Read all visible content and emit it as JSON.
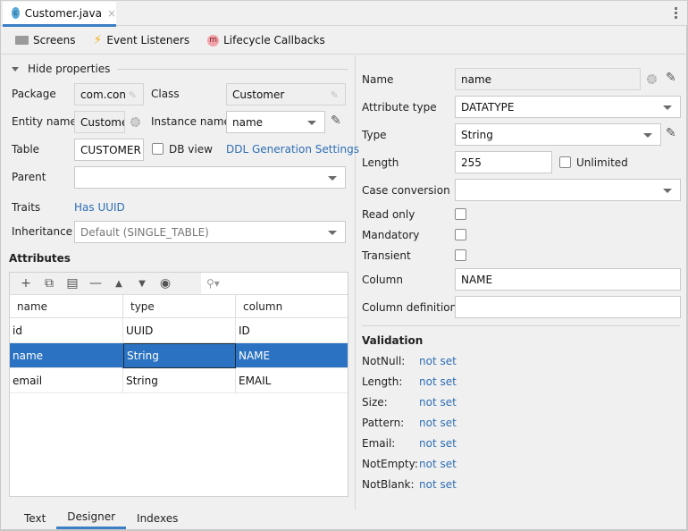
{
  "tabbar": {
    "file_tab": {
      "icon": "class-c-icon",
      "icon_letter": "c",
      "label": "Customer.java",
      "close": "×"
    },
    "more_icon": "more-vertical-icon"
  },
  "toolbar": {
    "items": [
      {
        "icon": "monitor-icon",
        "label": "Screens"
      },
      {
        "icon": "lightning-icon",
        "label": "Event Listeners"
      },
      {
        "icon": "method-m-icon",
        "icon_letter": "m",
        "label": "Lifecycle Callbacks"
      }
    ]
  },
  "properties": {
    "toggle_label": "Hide properties",
    "package": {
      "label": "Package",
      "value": "com.con"
    },
    "class": {
      "label": "Class",
      "value": "Customer"
    },
    "entity_name": {
      "label": "Entity name",
      "value": "Custome"
    },
    "instance_name": {
      "label": "Instance name",
      "value": "name"
    },
    "table": {
      "label": "Table",
      "value": "CUSTOMER"
    },
    "db_view": {
      "label": "DB view",
      "checked": false
    },
    "ddl_link": "DDL Generation Settings",
    "parent": {
      "label": "Parent",
      "value": ""
    },
    "traits": {
      "label": "Traits",
      "value": "Has UUID"
    },
    "inheritance": {
      "label": "Inheritance",
      "value": "Default (SINGLE_TABLE)"
    }
  },
  "attributes": {
    "title": "Attributes",
    "tools": [
      "add-icon",
      "copy-icon",
      "from-db-icon",
      "remove-icon",
      "move-up-icon",
      "move-down-icon",
      "eye-icon"
    ],
    "search_placeholder": "",
    "columns": [
      "name",
      "type",
      "column"
    ],
    "rows": [
      {
        "name": "id",
        "type": "UUID",
        "column": "ID",
        "selected": false
      },
      {
        "name": "name",
        "type": "String",
        "column": "NAME",
        "selected": true
      },
      {
        "name": "email",
        "type": "String",
        "column": "EMAIL",
        "selected": false
      }
    ]
  },
  "attribute_editor": {
    "name": {
      "label": "Name",
      "value": "name"
    },
    "attribute_type": {
      "label": "Attribute type",
      "value": "DATATYPE"
    },
    "type": {
      "label": "Type",
      "value": "String"
    },
    "length": {
      "label": "Length",
      "value": "255"
    },
    "unlimited": {
      "label": "Unlimited",
      "checked": false
    },
    "case_conversion": {
      "label": "Case conversion",
      "value": ""
    },
    "read_only": {
      "label": "Read only",
      "checked": false
    },
    "mandatory": {
      "label": "Mandatory",
      "checked": false
    },
    "transient": {
      "label": "Transient",
      "checked": false
    },
    "column": {
      "label": "Column",
      "value": "NAME"
    },
    "column_definition": {
      "label": "Column definition",
      "value": ""
    }
  },
  "validation": {
    "title": "Validation",
    "items": [
      {
        "label": "NotNull:",
        "value": "not set"
      },
      {
        "label": "Length:",
        "value": "not set"
      },
      {
        "label": "Size:",
        "value": "not set"
      },
      {
        "label": "Pattern:",
        "value": "not set"
      },
      {
        "label": "Email:",
        "value": "not set"
      },
      {
        "label": "NotEmpty:",
        "value": "not set"
      },
      {
        "label": "NotBlank:",
        "value": "not set"
      }
    ]
  },
  "bottom_tabs": [
    {
      "label": "Text",
      "active": false
    },
    {
      "label": "Designer",
      "active": true
    },
    {
      "label": "Indexes",
      "active": false
    }
  ],
  "colors": {
    "accent": "#3b7fc4",
    "selection": "#2b73c2",
    "link": "#2e6eb5"
  }
}
